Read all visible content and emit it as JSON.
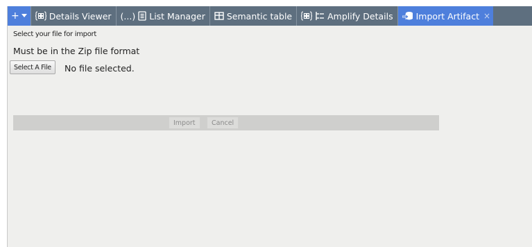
{
  "tabs": {
    "add_label": "+",
    "items": [
      {
        "label": "Details Viewer",
        "icon": "grid-braces-icon"
      },
      {
        "prefix": "(...)",
        "label": "List Manager",
        "icon": "document-list-icon"
      },
      {
        "label": "Semantic table",
        "icon": "table-icon"
      },
      {
        "label": "Amplify Details",
        "icon": "grid-braces-icon"
      },
      {
        "label": "Import Artifact",
        "icon": "import-database-icon",
        "active": true
      }
    ],
    "close_label": "×",
    "active_color": "#4e7fdc",
    "inactive_color": "#5e6f7f"
  },
  "form": {
    "instruction": "Select your file for import",
    "format_note": "Must be in the Zip file format",
    "file_button_label": "Select A File",
    "file_status": "No file selected."
  },
  "actions": {
    "import_label": "Import",
    "cancel_label": "Cancel"
  }
}
